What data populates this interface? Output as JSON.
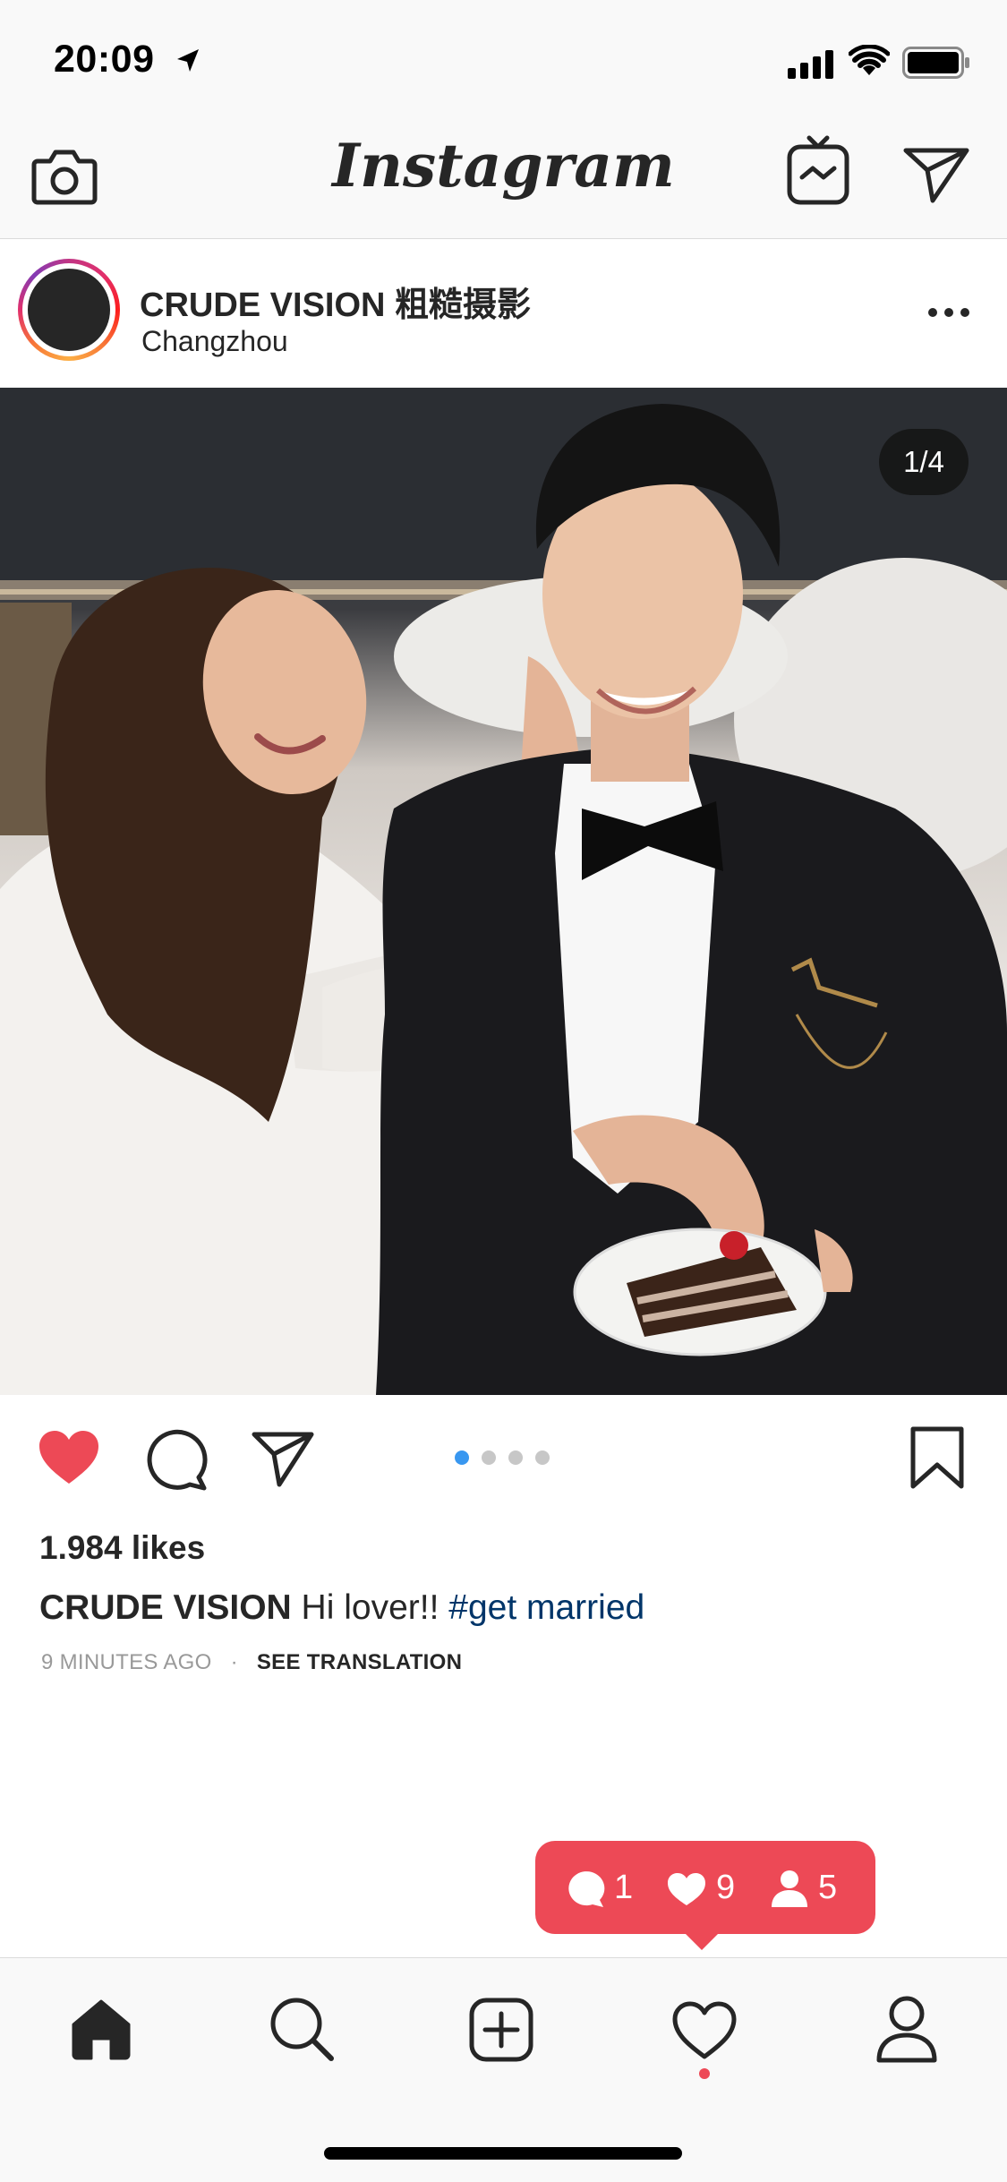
{
  "status_bar": {
    "time": "20:09"
  },
  "top_nav": {
    "title": "Instagram"
  },
  "post": {
    "username": "CRUDE VISION 粗糙摄影",
    "location": "Changzhou",
    "image_counter": "1/4",
    "likes": "1.984 likes",
    "caption": {
      "user": "CRUDE VISION",
      "text": "Hi lover!!",
      "hashtag": "#get married"
    },
    "time_ago": "9 MINUTES AGO",
    "separator": "·",
    "see_translation": "SEE TRANSLATION",
    "carousel": {
      "count": 4,
      "active_index": 0
    }
  },
  "activity": {
    "comments": "1",
    "likes": "9",
    "follows": "5"
  },
  "colors": {
    "like_red": "#ed4956",
    "hashtag_blue": "#003569",
    "active_dot": "#3897f0"
  },
  "icons": [
    "camera-icon",
    "igtv-icon",
    "direct-icon",
    "more-icon",
    "heart-filled-icon",
    "comment-icon",
    "share-icon",
    "bookmark-icon",
    "home-icon",
    "search-icon",
    "add-icon",
    "activity-heart-icon",
    "profile-icon"
  ]
}
